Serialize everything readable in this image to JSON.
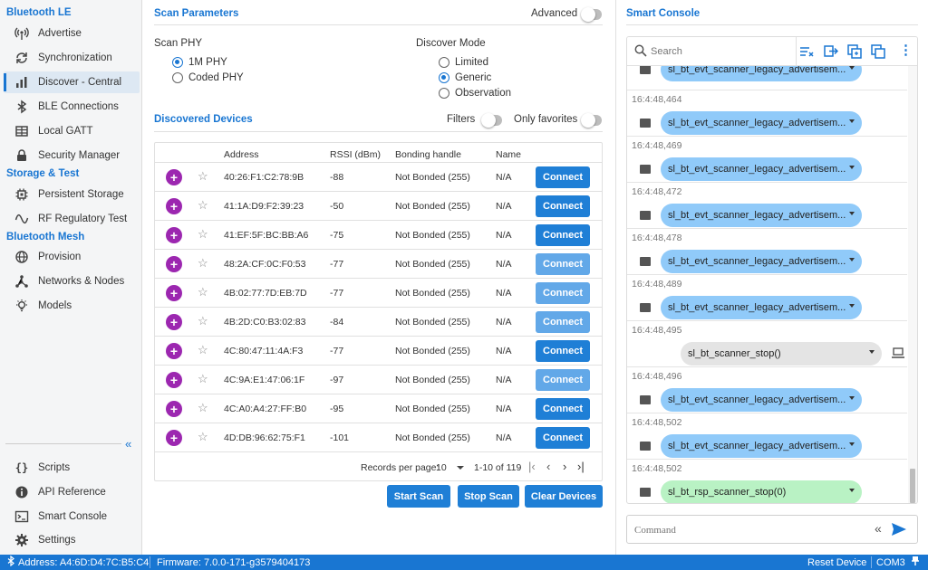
{
  "sidebar": {
    "sections": [
      {
        "title": "Bluetooth LE"
      },
      {
        "title": "Storage & Test"
      },
      {
        "title": "Bluetooth Mesh"
      }
    ],
    "items": [
      {
        "label": "Advertise",
        "icon": "broadcast-icon"
      },
      {
        "label": "Synchronization",
        "icon": "sync-icon"
      },
      {
        "label": "Discover - Central",
        "icon": "bar-chart-icon",
        "active": true
      },
      {
        "label": "BLE Connections",
        "icon": "bluetooth-icon"
      },
      {
        "label": "Local GATT",
        "icon": "table-icon"
      },
      {
        "label": "Security Manager",
        "icon": "lock-icon"
      },
      {
        "label": "Persistent Storage",
        "icon": "chip-icon"
      },
      {
        "label": "RF Regulatory Test",
        "icon": "wave-icon"
      },
      {
        "label": "Provision",
        "icon": "globe-icon"
      },
      {
        "label": "Networks & Nodes",
        "icon": "network-icon"
      },
      {
        "label": "Models",
        "icon": "bulb-icon"
      }
    ],
    "bottom_items": [
      {
        "label": "Scripts",
        "icon": "braces-icon"
      },
      {
        "label": "API Reference",
        "icon": "info-icon"
      },
      {
        "label": "Smart Console",
        "icon": "terminal-icon"
      },
      {
        "label": "Settings",
        "icon": "gear-icon"
      }
    ]
  },
  "scan": {
    "title": "Scan Parameters",
    "advanced_label": "Advanced",
    "phy_label": "Scan PHY",
    "phy_options": [
      "1M PHY",
      "Coded PHY"
    ],
    "phy_selected": "1M PHY",
    "mode_label": "Discover Mode",
    "mode_options": [
      "Limited",
      "Generic",
      "Observation"
    ],
    "mode_selected": "Generic"
  },
  "devices": {
    "title": "Discovered Devices",
    "filters_label": "Filters",
    "favorites_label": "Only favorites",
    "columns": [
      "Address",
      "RSSI (dBm)",
      "Bonding handle",
      "Name"
    ],
    "connect_label": "Connect",
    "rows": [
      {
        "address": "40:26:F1:C2:78:9B",
        "rssi": "-88",
        "bonding": "Not Bonded (255)",
        "name": "N/A",
        "emphasis": true
      },
      {
        "address": "41:1A:D9:F2:39:23",
        "rssi": "-50",
        "bonding": "Not Bonded (255)",
        "name": "N/A",
        "emphasis": true
      },
      {
        "address": "41:EF:5F:BC:BB:A6",
        "rssi": "-75",
        "bonding": "Not Bonded (255)",
        "name": "N/A",
        "emphasis": true
      },
      {
        "address": "48:2A:CF:0C:F0:53",
        "rssi": "-77",
        "bonding": "Not Bonded (255)",
        "name": "N/A",
        "emphasis": false
      },
      {
        "address": "4B:02:77:7D:EB:7D",
        "rssi": "-77",
        "bonding": "Not Bonded (255)",
        "name": "N/A",
        "emphasis": false
      },
      {
        "address": "4B:2D:C0:B3:02:83",
        "rssi": "-84",
        "bonding": "Not Bonded (255)",
        "name": "N/A",
        "emphasis": false
      },
      {
        "address": "4C:80:47:11:4A:F3",
        "rssi": "-77",
        "bonding": "Not Bonded (255)",
        "name": "N/A",
        "emphasis": true
      },
      {
        "address": "4C:9A:E1:47:06:1F",
        "rssi": "-97",
        "bonding": "Not Bonded (255)",
        "name": "N/A",
        "emphasis": false
      },
      {
        "address": "4C:A0:A4:27:FF:B0",
        "rssi": "-95",
        "bonding": "Not Bonded (255)",
        "name": "N/A",
        "emphasis": true
      },
      {
        "address": "4D:DB:96:62:75:F1",
        "rssi": "-101",
        "bonding": "Not Bonded (255)",
        "name": "N/A",
        "emphasis": true
      }
    ],
    "pager": {
      "records_label": "Records per page:",
      "per_page": "10",
      "range": "1-10 of 119"
    }
  },
  "actions": {
    "start": "Start Scan",
    "stop": "Stop Scan",
    "clear": "Clear Devices"
  },
  "console": {
    "title": "Smart Console",
    "search_placeholder": "Search",
    "entries": [
      {
        "ts": "",
        "text": "sl_bt_evt_scanner_legacy_advertisem...",
        "kind": "evt"
      },
      {
        "ts": "16:4:48,464",
        "text": "sl_bt_evt_scanner_legacy_advertisem...",
        "kind": "evt"
      },
      {
        "ts": "16:4:48,469",
        "text": "sl_bt_evt_scanner_legacy_advertisem...",
        "kind": "evt"
      },
      {
        "ts": "16:4:48,472",
        "text": "sl_bt_evt_scanner_legacy_advertisem...",
        "kind": "evt"
      },
      {
        "ts": "16:4:48,478",
        "text": "sl_bt_evt_scanner_legacy_advertisem...",
        "kind": "evt"
      },
      {
        "ts": "16:4:48,489",
        "text": "sl_bt_evt_scanner_legacy_advertisem...",
        "kind": "evt"
      },
      {
        "ts": "16:4:48,495",
        "text": "sl_bt_scanner_stop()",
        "kind": "cmd"
      },
      {
        "ts": "16:4:48,496",
        "text": "sl_bt_evt_scanner_legacy_advertisem...",
        "kind": "evt"
      },
      {
        "ts": "16:4:48,502",
        "text": "sl_bt_evt_scanner_legacy_advertisem...",
        "kind": "evt"
      },
      {
        "ts": "16:4:48,502",
        "text": "sl_bt_rsp_scanner_stop(0)",
        "kind": "rsp"
      }
    ],
    "command_placeholder": "Command"
  },
  "status": {
    "address": "Address: A4:6D:D4:7C:B5:C4",
    "firmware": "Firmware: 7.0.0-171-g3579404173",
    "reset": "Reset Device",
    "port": "COM3"
  },
  "colors": {
    "accent": "#1976d2",
    "button": "#1f7fd6",
    "button_light": "#62a8e8",
    "plus_badge": "#9c27b0",
    "event_bubble": "#90caf9",
    "response_bubble": "#b9f2c4",
    "command_bubble": "#e4e4e4"
  }
}
